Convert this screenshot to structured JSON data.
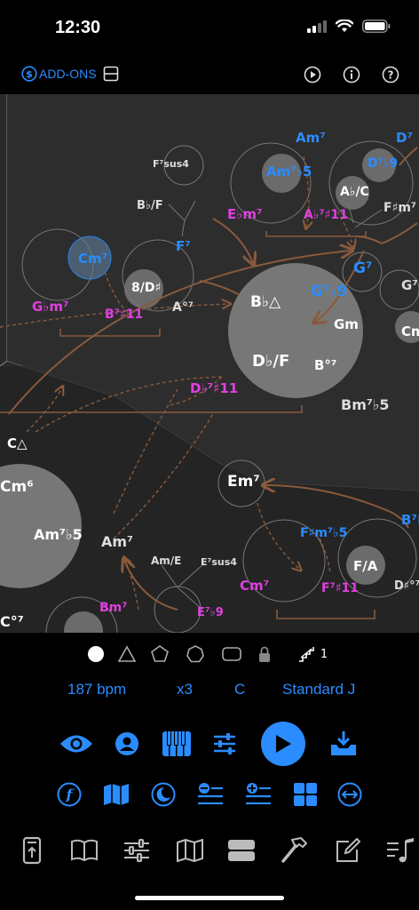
{
  "status": {
    "time": "12:30"
  },
  "topbar": {
    "addons_label": "ADD-ONS"
  },
  "chords": [
    {
      "label": "Am⁷",
      "color": "#2a8cff"
    },
    {
      "label": "D⁷",
      "color": "#2a8cff"
    },
    {
      "label": "F⁷sus4",
      "color": "#dddddd"
    },
    {
      "label": "Am⁷♭5",
      "color": "#2a8cff"
    },
    {
      "label": "D⁷♭9",
      "color": "#2a8cff"
    },
    {
      "label": "B♭/F",
      "color": "#dddddd"
    },
    {
      "label": "A♭/C",
      "color": "#ffffff"
    },
    {
      "label": "F♯m⁷",
      "color": "#dddddd"
    },
    {
      "label": "E♭m⁷",
      "color": "#e040e0"
    },
    {
      "label": "A♭⁷♯11",
      "color": "#e040e0"
    },
    {
      "label": "F⁷",
      "color": "#2a8cff"
    },
    {
      "label": "Cm⁷",
      "color": "#2a8cff"
    },
    {
      "label": "G⁷",
      "color": "#2a8cff"
    },
    {
      "label": "8/D♯",
      "color": "#ffffff"
    },
    {
      "label": "B♭△",
      "color": "#ffffff"
    },
    {
      "label": "G⁷♭9",
      "color": "#2a8cff"
    },
    {
      "label": "G♭m⁷",
      "color": "#e040e0"
    },
    {
      "label": "B⁷♯11",
      "color": "#e040e0"
    },
    {
      "label": "A°⁷",
      "color": "#dddddd"
    },
    {
      "label": "Gm",
      "color": "#ffffff"
    },
    {
      "label": "G⁷",
      "color": "#dddddd"
    },
    {
      "label": "Cm",
      "color": "#ffffff"
    },
    {
      "label": "D♭/F",
      "color": "#ffffff"
    },
    {
      "label": "B°⁷",
      "color": "#ffffff"
    },
    {
      "label": "D♭⁷♯11",
      "color": "#e040e0"
    },
    {
      "label": "Bm⁷♭5",
      "color": "#dddddd"
    },
    {
      "label": "C△",
      "color": "#ffffff"
    },
    {
      "label": "Em⁷",
      "color": "#ffffff"
    },
    {
      "label": "Cm⁶",
      "color": "#ffffff"
    },
    {
      "label": "Am⁷♭5",
      "color": "#ffffff"
    },
    {
      "label": "Am⁷",
      "color": "#dddddd"
    },
    {
      "label": "F♯m⁷♭5",
      "color": "#2a8cff"
    },
    {
      "label": "B⁷♭",
      "color": "#2a8cff"
    },
    {
      "label": "Am/E",
      "color": "#dddddd"
    },
    {
      "label": "E⁷sus4",
      "color": "#dddddd"
    },
    {
      "label": "F/A",
      "color": "#ffffff"
    },
    {
      "label": "Cm⁷",
      "color": "#e040e0"
    },
    {
      "label": "F⁷♯11",
      "color": "#e040e0"
    },
    {
      "label": "D♯°⁷",
      "color": "#dddddd"
    },
    {
      "label": "C°⁷",
      "color": "#ffffff"
    },
    {
      "label": "Bm⁷",
      "color": "#e040e0"
    },
    {
      "label": "E⁷♭9",
      "color": "#e040e0"
    }
  ],
  "shapes": {
    "step_count": "1"
  },
  "transport": {
    "tempo": "187 bpm",
    "repeat": "x3",
    "key": "C",
    "style": "Standard J"
  },
  "colors": {
    "accent": "#2a8cff",
    "magenta": "#e040e0",
    "canvas": "#2a2a2a",
    "arrow": "#8a5a3c"
  }
}
